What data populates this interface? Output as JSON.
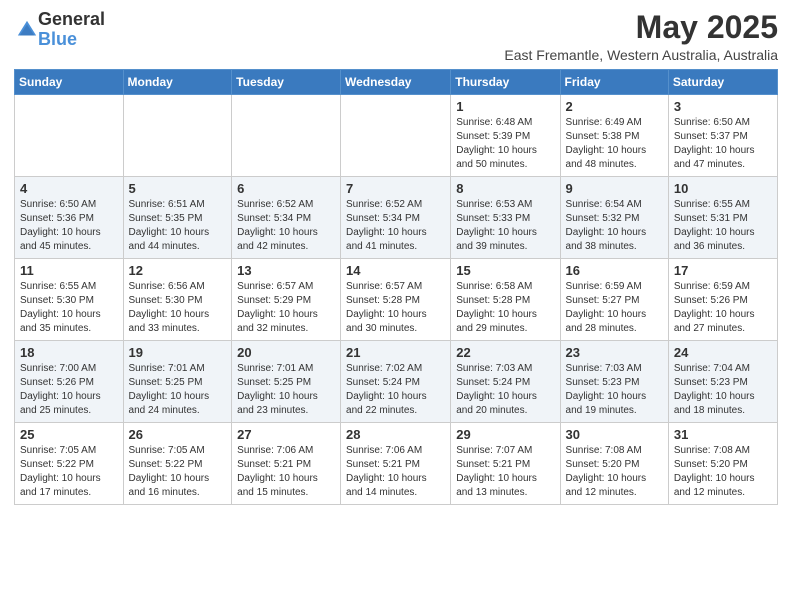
{
  "header": {
    "logo_general": "General",
    "logo_blue": "Blue",
    "main_title": "May 2025",
    "subtitle": "East Fremantle, Western Australia, Australia"
  },
  "columns": [
    "Sunday",
    "Monday",
    "Tuesday",
    "Wednesday",
    "Thursday",
    "Friday",
    "Saturday"
  ],
  "weeks": [
    {
      "days": [
        {
          "num": "",
          "info": ""
        },
        {
          "num": "",
          "info": ""
        },
        {
          "num": "",
          "info": ""
        },
        {
          "num": "",
          "info": ""
        },
        {
          "num": "1",
          "info": "Sunrise: 6:48 AM\nSunset: 5:39 PM\nDaylight: 10 hours\nand 50 minutes."
        },
        {
          "num": "2",
          "info": "Sunrise: 6:49 AM\nSunset: 5:38 PM\nDaylight: 10 hours\nand 48 minutes."
        },
        {
          "num": "3",
          "info": "Sunrise: 6:50 AM\nSunset: 5:37 PM\nDaylight: 10 hours\nand 47 minutes."
        }
      ]
    },
    {
      "days": [
        {
          "num": "4",
          "info": "Sunrise: 6:50 AM\nSunset: 5:36 PM\nDaylight: 10 hours\nand 45 minutes."
        },
        {
          "num": "5",
          "info": "Sunrise: 6:51 AM\nSunset: 5:35 PM\nDaylight: 10 hours\nand 44 minutes."
        },
        {
          "num": "6",
          "info": "Sunrise: 6:52 AM\nSunset: 5:34 PM\nDaylight: 10 hours\nand 42 minutes."
        },
        {
          "num": "7",
          "info": "Sunrise: 6:52 AM\nSunset: 5:34 PM\nDaylight: 10 hours\nand 41 minutes."
        },
        {
          "num": "8",
          "info": "Sunrise: 6:53 AM\nSunset: 5:33 PM\nDaylight: 10 hours\nand 39 minutes."
        },
        {
          "num": "9",
          "info": "Sunrise: 6:54 AM\nSunset: 5:32 PM\nDaylight: 10 hours\nand 38 minutes."
        },
        {
          "num": "10",
          "info": "Sunrise: 6:55 AM\nSunset: 5:31 PM\nDaylight: 10 hours\nand 36 minutes."
        }
      ]
    },
    {
      "days": [
        {
          "num": "11",
          "info": "Sunrise: 6:55 AM\nSunset: 5:30 PM\nDaylight: 10 hours\nand 35 minutes."
        },
        {
          "num": "12",
          "info": "Sunrise: 6:56 AM\nSunset: 5:30 PM\nDaylight: 10 hours\nand 33 minutes."
        },
        {
          "num": "13",
          "info": "Sunrise: 6:57 AM\nSunset: 5:29 PM\nDaylight: 10 hours\nand 32 minutes."
        },
        {
          "num": "14",
          "info": "Sunrise: 6:57 AM\nSunset: 5:28 PM\nDaylight: 10 hours\nand 30 minutes."
        },
        {
          "num": "15",
          "info": "Sunrise: 6:58 AM\nSunset: 5:28 PM\nDaylight: 10 hours\nand 29 minutes."
        },
        {
          "num": "16",
          "info": "Sunrise: 6:59 AM\nSunset: 5:27 PM\nDaylight: 10 hours\nand 28 minutes."
        },
        {
          "num": "17",
          "info": "Sunrise: 6:59 AM\nSunset: 5:26 PM\nDaylight: 10 hours\nand 27 minutes."
        }
      ]
    },
    {
      "days": [
        {
          "num": "18",
          "info": "Sunrise: 7:00 AM\nSunset: 5:26 PM\nDaylight: 10 hours\nand 25 minutes."
        },
        {
          "num": "19",
          "info": "Sunrise: 7:01 AM\nSunset: 5:25 PM\nDaylight: 10 hours\nand 24 minutes."
        },
        {
          "num": "20",
          "info": "Sunrise: 7:01 AM\nSunset: 5:25 PM\nDaylight: 10 hours\nand 23 minutes."
        },
        {
          "num": "21",
          "info": "Sunrise: 7:02 AM\nSunset: 5:24 PM\nDaylight: 10 hours\nand 22 minutes."
        },
        {
          "num": "22",
          "info": "Sunrise: 7:03 AM\nSunset: 5:24 PM\nDaylight: 10 hours\nand 20 minutes."
        },
        {
          "num": "23",
          "info": "Sunrise: 7:03 AM\nSunset: 5:23 PM\nDaylight: 10 hours\nand 19 minutes."
        },
        {
          "num": "24",
          "info": "Sunrise: 7:04 AM\nSunset: 5:23 PM\nDaylight: 10 hours\nand 18 minutes."
        }
      ]
    },
    {
      "days": [
        {
          "num": "25",
          "info": "Sunrise: 7:05 AM\nSunset: 5:22 PM\nDaylight: 10 hours\nand 17 minutes."
        },
        {
          "num": "26",
          "info": "Sunrise: 7:05 AM\nSunset: 5:22 PM\nDaylight: 10 hours\nand 16 minutes."
        },
        {
          "num": "27",
          "info": "Sunrise: 7:06 AM\nSunset: 5:21 PM\nDaylight: 10 hours\nand 15 minutes."
        },
        {
          "num": "28",
          "info": "Sunrise: 7:06 AM\nSunset: 5:21 PM\nDaylight: 10 hours\nand 14 minutes."
        },
        {
          "num": "29",
          "info": "Sunrise: 7:07 AM\nSunset: 5:21 PM\nDaylight: 10 hours\nand 13 minutes."
        },
        {
          "num": "30",
          "info": "Sunrise: 7:08 AM\nSunset: 5:20 PM\nDaylight: 10 hours\nand 12 minutes."
        },
        {
          "num": "31",
          "info": "Sunrise: 7:08 AM\nSunset: 5:20 PM\nDaylight: 10 hours\nand 12 minutes."
        }
      ]
    }
  ]
}
